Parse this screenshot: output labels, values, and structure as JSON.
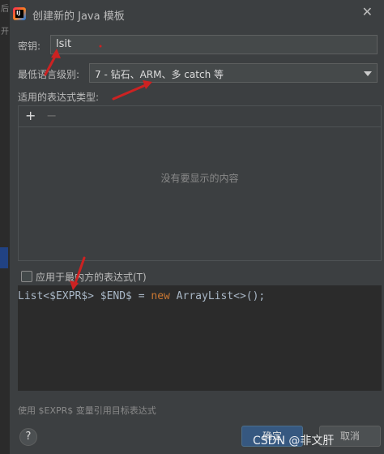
{
  "edge": {
    "chars": [
      "后",
      "开"
    ]
  },
  "window": {
    "title": "创建新的 Java 模板",
    "close_glyph": "✕"
  },
  "key": {
    "label": "密钥:",
    "value": "lsit"
  },
  "language_level": {
    "label": "最低语言级别:",
    "selected": "7 - 钻石、ARM、多 catch 等"
  },
  "expression_types": {
    "label": "适用的表达式类型:",
    "add_glyph": "+",
    "remove_glyph": "−",
    "empty_text": "没有要显示的内容"
  },
  "innermost": {
    "label": "应用于最内方的表达式(T)",
    "checked": false
  },
  "template": {
    "code_before": "List<$EXPR$> $END$ = ",
    "code_keyword": "new",
    "code_after": " ArrayList<>();"
  },
  "hint": "使用 $EXPR$ 变量引用目标表达式",
  "buttons": {
    "help": "?",
    "ok": "确定",
    "cancel": "取消"
  },
  "watermark": "CSDN @非文肝",
  "colors": {
    "background": "#3c3f41",
    "editor": "#2b2b2b",
    "primary_button": "#365880",
    "annotation_arrow": "#cc2222",
    "keyword": "#cc7832"
  },
  "icons": {
    "app": "intellij-idea-icon",
    "close": "close-icon",
    "caret": "chevron-down-icon",
    "help": "question-icon"
  }
}
